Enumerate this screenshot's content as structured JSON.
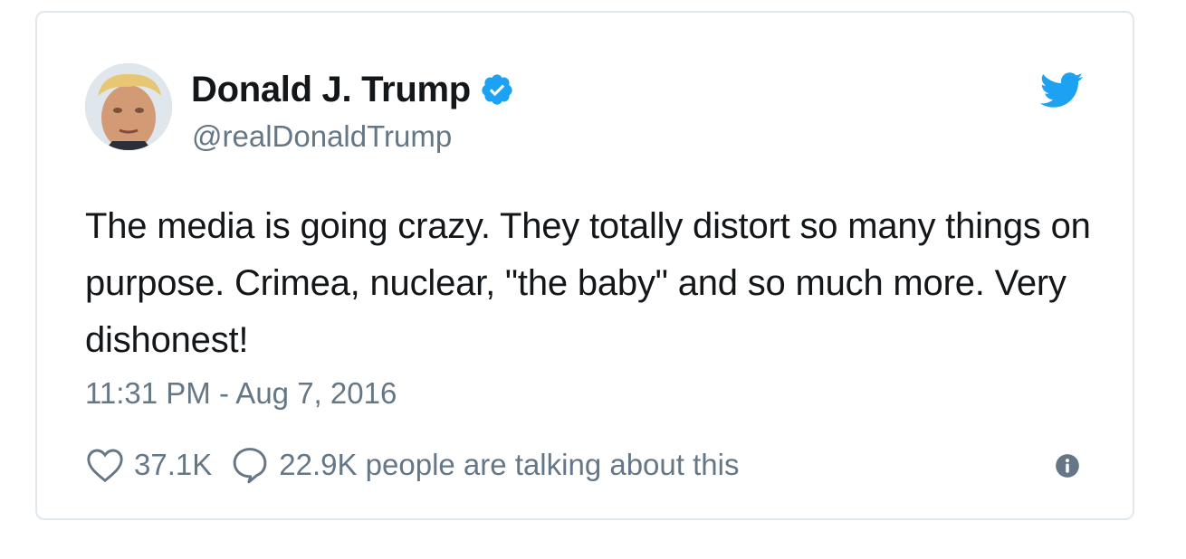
{
  "tweet": {
    "display_name": "Donald J. Trump",
    "handle": "@realDonaldTrump",
    "text": "The media is going crazy. They totally distort so many things on purpose. Crimea, nuclear, \"the baby\" and so much more. Very dishonest!",
    "timestamp": "11:31 PM - Aug 7, 2016",
    "likes": "37.1K",
    "talking": "22.9K people are talking about this"
  },
  "icons": {
    "verified": "verified-badge-icon",
    "bird": "twitter-bird-icon",
    "like": "heart-icon",
    "reply": "speech-bubble-icon",
    "info": "info-icon"
  },
  "colors": {
    "brand_blue": "#1da1f2",
    "text": "#14171a",
    "muted": "#657786",
    "border": "#e1e8ed"
  }
}
